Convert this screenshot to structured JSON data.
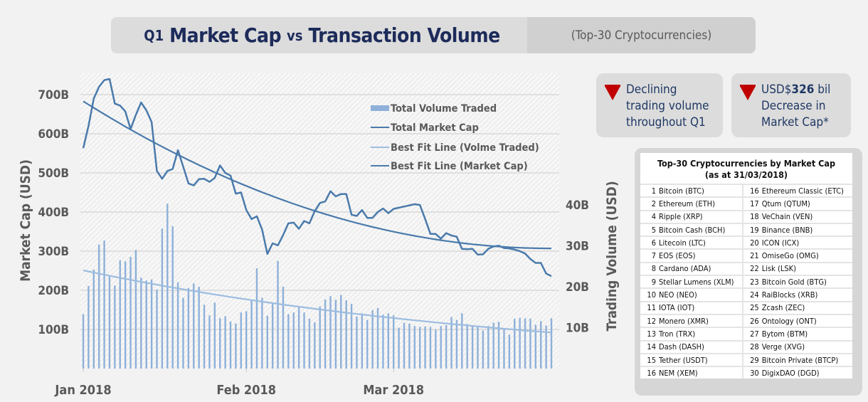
{
  "header": {
    "q1": "Q1",
    "market_cap": "Market Cap",
    "vs": "vs",
    "transaction_volume": "Transaction Volume",
    "subtitle": "(Top-30 Cryptocurrencies)"
  },
  "callouts": [
    {
      "icon": "down-triangle-icon",
      "lines": [
        "Declining",
        "trading volume",
        "throughout Q1"
      ]
    },
    {
      "icon": "down-triangle-icon",
      "prefix": "USD$",
      "value": "326",
      "suffix": " bil",
      "lines2": [
        "Decrease in",
        "Market Cap*"
      ]
    }
  ],
  "top30_table": {
    "title_line1": "Top-30 Cryptocurrencies by Market Cap",
    "title_line2": "(as at 31/03/2018)",
    "rows": [
      [
        {
          "n": "1",
          "name": "Bitcoin (BTC)"
        },
        {
          "n": "16",
          "name": "Ethereum Classic (ETC)"
        }
      ],
      [
        {
          "n": "2",
          "name": "Ethereum (ETH)"
        },
        {
          "n": "17",
          "name": "Qtum (QTUM)"
        }
      ],
      [
        {
          "n": "4",
          "name": "Ripple (XRP)"
        },
        {
          "n": "18",
          "name": "VeChain (VEN)"
        }
      ],
      [
        {
          "n": "5",
          "name": "Bitcoin Cash (BCH)"
        },
        {
          "n": "19",
          "name": "Binance (BNB)"
        }
      ],
      [
        {
          "n": "6",
          "name": "Litecoin (LTC)"
        },
        {
          "n": "20",
          "name": "ICON (ICX)"
        }
      ],
      [
        {
          "n": "7",
          "name": "EOS (EOS)"
        },
        {
          "n": "21",
          "name": "OmiseGo (OMG)"
        }
      ],
      [
        {
          "n": "8",
          "name": "Cardano (ADA)"
        },
        {
          "n": "22",
          "name": "Lisk (LSK)"
        }
      ],
      [
        {
          "n": "9",
          "name": "Stellar Lumens (XLM)"
        },
        {
          "n": "23",
          "name": "Bitcoin Gold (BTG)"
        }
      ],
      [
        {
          "n": "10",
          "name": "NEO (NEO)"
        },
        {
          "n": "24",
          "name": "RaiBlocks (XRB)"
        }
      ],
      [
        {
          "n": "11",
          "name": "IOTA (IOT)"
        },
        {
          "n": "25",
          "name": "Zcash (ZEC)"
        }
      ],
      [
        {
          "n": "12",
          "name": "Monero (XMR)"
        },
        {
          "n": "26",
          "name": "Ontology (ONT)"
        }
      ],
      [
        {
          "n": "13",
          "name": "Tron (TRX)"
        },
        {
          "n": "27",
          "name": "Bytom (BTM)"
        }
      ],
      [
        {
          "n": "14",
          "name": "Dash (DASH)"
        },
        {
          "n": "28",
          "name": "Verge  (XVG)"
        }
      ],
      [
        {
          "n": "15",
          "name": "Tether (USDT)"
        },
        {
          "n": "29",
          "name": "Bitcoin Private (BTCP)"
        }
      ],
      [
        {
          "n": "16",
          "name": "NEM (XEM)"
        },
        {
          "n": "30",
          "name": "DigixDAO (DGD)"
        }
      ]
    ]
  },
  "colors": {
    "market_cap_line": "#4a7aab",
    "volume_bars": "#8eb0d9",
    "fit_volume": "#9dbde0",
    "fit_market_cap": "#4a7aab",
    "title_text": "#1c2b5a",
    "alert_red": "#c00000",
    "callout_text": "#1f3864"
  },
  "chart_data": {
    "type": "bar+line",
    "title": "Q1 Market Cap vs Transaction Volume (Top-30 Cryptocurrencies)",
    "xlabel": "",
    "ylabel_left": "Market Cap (USD)",
    "ylabel_right": "Trading Volume (USD)",
    "x_ticks": [
      "Jan 2018",
      "Feb 2018",
      "Mar 2018"
    ],
    "y_left_ticks": [
      "100B",
      "200B",
      "300B",
      "400B",
      "500B",
      "600B",
      "700B"
    ],
    "y_left_range_billions": [
      0,
      750
    ],
    "y_right_ticks": [
      "10B",
      "20B",
      "30B",
      "40B"
    ],
    "y_right_range_billions": [
      0,
      42
    ],
    "grid": true,
    "legend_position": "top-right",
    "legend": [
      "Total Volume Traded",
      "Total Market Cap",
      "Best Fit Line (Volme Traded)",
      "Best Fit Line (Market Cap)"
    ],
    "days": 90,
    "series": [
      {
        "name": "Total Volume Traded",
        "type": "bar",
        "axis": "right",
        "unit": "billion USD",
        "values": [
          13.3,
          20.2,
          24.2,
          30.3,
          31.3,
          22.5,
          20.3,
          26.5,
          26.2,
          27.3,
          29.0,
          22.2,
          21.5,
          21.8,
          19.3,
          34.2,
          40.3,
          34.8,
          21.1,
          17.3,
          19.7,
          20.8,
          20.0,
          15.6,
          13.0,
          16.1,
          12.3,
          12.8,
          11.5,
          11.0,
          13.7,
          14.0,
          16.8,
          24.5,
          17.3,
          12.9,
          15.9,
          26.3,
          20.0,
          13.3,
          13.7,
          14.9,
          13.7,
          12.2,
          11.3,
          15.2,
          16.9,
          17.7,
          16.8,
          18.0,
          16.7,
          15.8,
          12.7,
          13.5,
          11.9,
          14.3,
          14.8,
          13.2,
          13.5,
          13.0,
          10.0,
          11.2,
          11.0,
          10.4,
          10.2,
          10.3,
          10.2,
          9.5,
          10.4,
          10.6,
          12.6,
          11.9,
          13.5,
          10.9,
          10.5,
          10.5,
          9.3,
          10.4,
          11.2,
          11.4,
          9.7,
          8.3,
          12.2,
          12.4,
          12.3,
          12.2,
          10.7,
          11.6,
          10.5,
          12.3
        ]
      },
      {
        "name": "Total Market Cap",
        "type": "line",
        "axis": "left",
        "unit": "billion USD",
        "values": [
          563,
          620,
          690,
          720,
          737,
          740,
          677,
          672,
          657,
          612,
          648,
          680,
          660,
          630,
          505,
          485,
          505,
          510,
          558,
          516,
          473,
          468,
          484,
          485,
          477,
          487,
          519,
          500,
          493,
          447,
          450,
          405,
          382,
          389,
          355,
          293,
          320,
          315,
          341,
          371,
          373,
          357,
          377,
          371,
          402,
          423,
          427,
          453,
          440,
          446,
          446,
          393,
          390,
          405,
          385,
          385,
          400,
          409,
          397,
          408,
          411,
          414,
          417,
          420,
          418,
          382,
          344,
          344,
          332,
          346,
          340,
          337,
          306,
          305,
          306,
          291,
          292,
          306,
          312,
          314,
          308,
          307,
          304,
          300,
          294,
          280,
          270,
          270,
          243,
          236
        ]
      },
      {
        "name": "Best Fit Line (Volme Traded)",
        "type": "line",
        "axis": "right",
        "unit": "billion USD",
        "start": 24.0,
        "end": 8.8,
        "model": "exponential"
      },
      {
        "name": "Best Fit Line (Market Cap)",
        "type": "line",
        "axis": "left",
        "unit": "billion USD",
        "start": 683,
        "end": 307,
        "model": "quadratic"
      }
    ]
  }
}
